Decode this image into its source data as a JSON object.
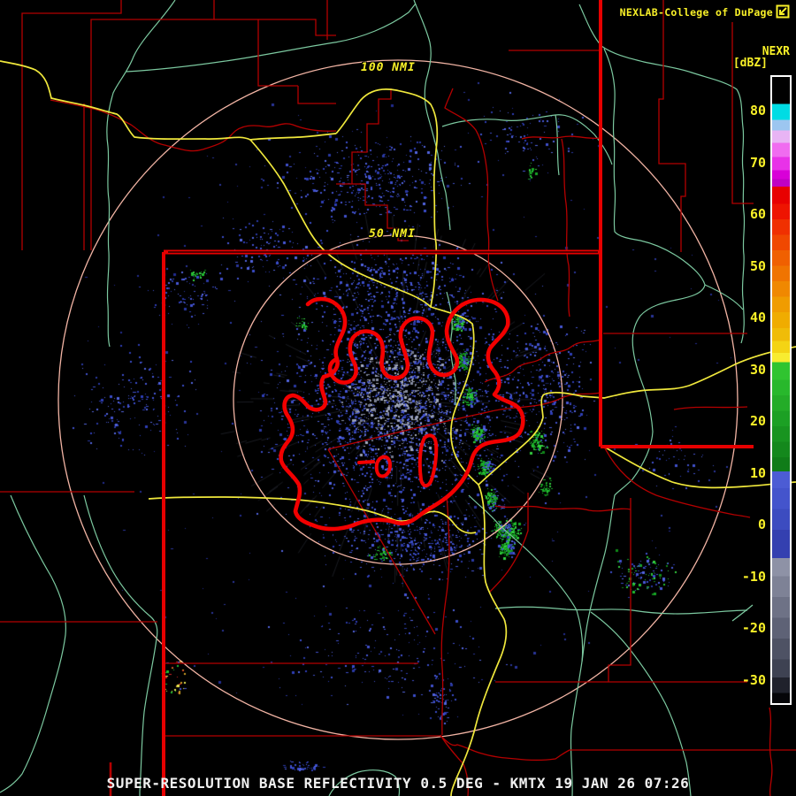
{
  "header": {
    "credit": "NEXLAB-College of DuPage",
    "logo_icon": "nexlab-logo-icon"
  },
  "colorbar": {
    "product_label": "NEXR",
    "units_label": "[dBZ]",
    "value_range": {
      "max": 86.5,
      "min": -34.5
    },
    "ticks": [
      {
        "label": "80",
        "value": 80
      },
      {
        "label": "70",
        "value": 70
      },
      {
        "label": "60",
        "value": 60
      },
      {
        "label": "50",
        "value": 50
      },
      {
        "label": "40",
        "value": 40
      },
      {
        "label": "30",
        "value": 30
      },
      {
        "label": "20",
        "value": 20
      },
      {
        "label": "10",
        "value": 10
      },
      {
        "label": "0",
        "value": 0
      },
      {
        "label": "-10",
        "value": -10
      },
      {
        "label": "-20",
        "value": -20
      },
      {
        "label": "-30",
        "value": -30
      }
    ],
    "segments": [
      {
        "from": 86.5,
        "to": 81.3,
        "color": "#000000"
      },
      {
        "from": 81.3,
        "to": 78.2,
        "color": "#00dce4"
      },
      {
        "from": 78.2,
        "to": 76.2,
        "color": "#9cc6f0"
      },
      {
        "from": 76.2,
        "to": 73.8,
        "color": "#e8b4f4"
      },
      {
        "from": 73.8,
        "to": 71.0,
        "color": "#f06cf0"
      },
      {
        "from": 71.0,
        "to": 68.5,
        "color": "#e832e8"
      },
      {
        "from": 68.5,
        "to": 66.8,
        "color": "#d800d8"
      },
      {
        "from": 66.8,
        "to": 65.3,
        "color": "#c000c4"
      },
      {
        "from": 65.3,
        "to": 62.0,
        "color": "#e80000"
      },
      {
        "from": 62.0,
        "to": 59.0,
        "color": "#ee1400"
      },
      {
        "from": 59.0,
        "to": 56.0,
        "color": "#f03000"
      },
      {
        "from": 56.0,
        "to": 53.0,
        "color": "#f04800"
      },
      {
        "from": 53.0,
        "to": 50.0,
        "color": "#f06000"
      },
      {
        "from": 50.0,
        "to": 47.0,
        "color": "#f07400"
      },
      {
        "from": 47.0,
        "to": 44.0,
        "color": "#f08800"
      },
      {
        "from": 44.0,
        "to": 41.0,
        "color": "#f09c00"
      },
      {
        "from": 41.0,
        "to": 38.0,
        "color": "#f0ac00"
      },
      {
        "from": 38.0,
        "to": 35.5,
        "color": "#f0bc08"
      },
      {
        "from": 35.5,
        "to": 33.2,
        "color": "#f4d414"
      },
      {
        "from": 33.2,
        "to": 31.4,
        "color": "#f8ec30"
      },
      {
        "from": 31.4,
        "to": 28.0,
        "color": "#30c430"
      },
      {
        "from": 28.0,
        "to": 25.0,
        "color": "#28b82c"
      },
      {
        "from": 25.0,
        "to": 22.0,
        "color": "#24ac28"
      },
      {
        "from": 22.0,
        "to": 19.0,
        "color": "#1ca024"
      },
      {
        "from": 19.0,
        "to": 16.0,
        "color": "#189420"
      },
      {
        "from": 16.0,
        "to": 13.0,
        "color": "#14881c"
      },
      {
        "from": 13.0,
        "to": 10.3,
        "color": "#107c18"
      },
      {
        "from": 10.3,
        "to": 7.0,
        "color": "#4c5cd4"
      },
      {
        "from": 7.0,
        "to": 3.0,
        "color": "#4454cc"
      },
      {
        "from": 3.0,
        "to": -1.0,
        "color": "#3c4cc0"
      },
      {
        "from": -1.0,
        "to": -6.5,
        "color": "#3440b0"
      },
      {
        "from": -6.5,
        "to": -10.0,
        "color": "#8e92a6"
      },
      {
        "from": -10.0,
        "to": -14.0,
        "color": "#7e8296"
      },
      {
        "from": -14.0,
        "to": -18.0,
        "color": "#6e7286"
      },
      {
        "from": -18.0,
        "to": -22.0,
        "color": "#5e6276"
      },
      {
        "from": -22.0,
        "to": -26.0,
        "color": "#4e5264"
      },
      {
        "from": -26.0,
        "to": -29.5,
        "color": "#3e4252"
      },
      {
        "from": -29.5,
        "to": -32.5,
        "color": "#20222c"
      },
      {
        "from": -32.5,
        "to": -34.5,
        "color": "#050508"
      }
    ]
  },
  "rings": {
    "outer_label": "100 NMI",
    "inner_label": "50 NMI"
  },
  "footer": {
    "title": "SUPER-RESOLUTION BASE REFLECTIVITY 0.5 DEG - KMTX 19 JAN 26 07:26"
  },
  "colors": {
    "background": "#000000",
    "state_border": "#e60000",
    "county_border": "#b40000",
    "highway": "#f0e83c",
    "river": "#7cc9a0",
    "range_ring": "#f2b4a4",
    "lake_outline": "#f20000",
    "label_yellow": "#f8f028",
    "title_white": "#f0f0f0",
    "colorbar_border": "#ffffff",
    "echo_palette": {
      "blue": [
        "#2e3eb6",
        "#3a4cc8",
        "#4656d4",
        "#5264de",
        "#2a38a2",
        "#4050cc"
      ],
      "gray": [
        "#868ca2",
        "#989eb2",
        "#747a8e",
        "#a6acbe"
      ],
      "green": [
        "#18a426",
        "#22bc30",
        "#34d040",
        "#0f8818"
      ],
      "mixed": [
        "#d02424",
        "#22bc30",
        "#4656d4",
        "#d0a024",
        "#e8e850"
      ],
      "dim": [
        "#222c90",
        "#2a3498"
      ]
    }
  }
}
